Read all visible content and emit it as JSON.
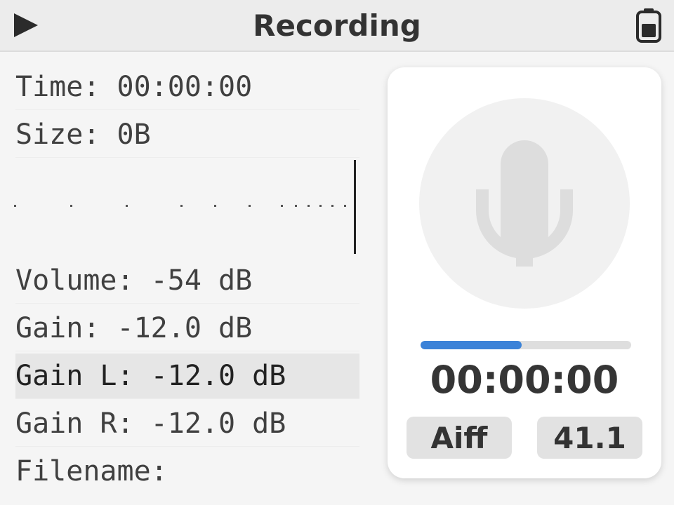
{
  "header": {
    "title": "Recording",
    "play_icon": "play-icon",
    "battery_icon": "battery-icon"
  },
  "info": {
    "time": "Time: 00:00:00",
    "size": "Size: 0B",
    "volume": "Volume: -54 dB",
    "gain": "Gain: -12.0 dB",
    "gain_l": "Gain L: -12.0 dB",
    "gain_r": "Gain R: -12.0 dB",
    "filename": "Filename:"
  },
  "recorder": {
    "mic_icon": "microphone-icon",
    "progress": 0.48,
    "timer": "00:00:00",
    "format": "Aiff",
    "sample_rate": "41.1"
  },
  "colors": {
    "accent": "#3b82d8",
    "background": "#f5f5f5",
    "card": "#ffffff"
  }
}
